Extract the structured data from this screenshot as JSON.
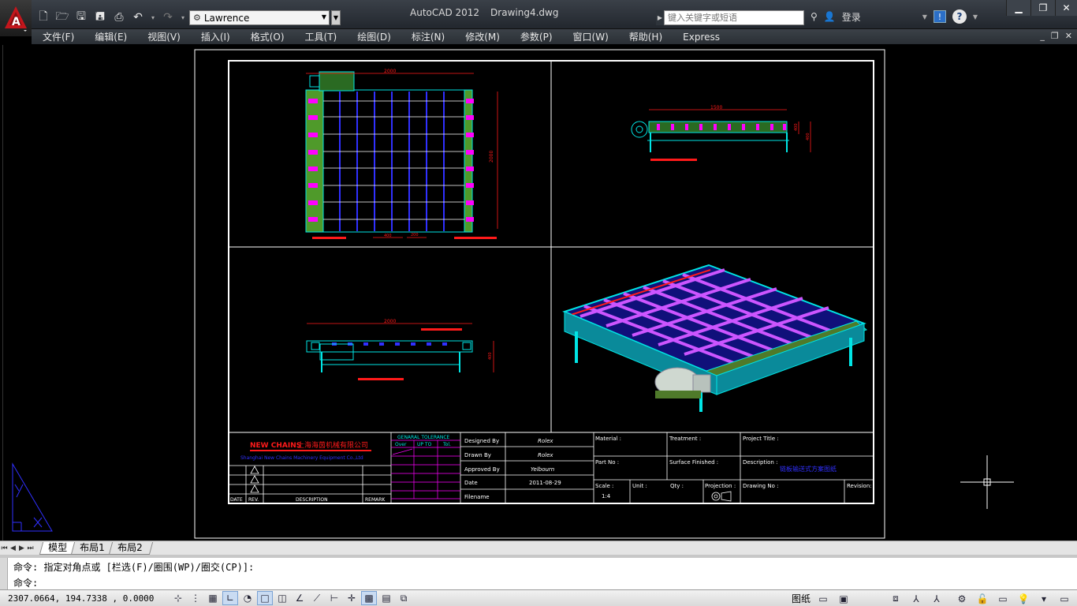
{
  "app": {
    "name": "AutoCAD 2012",
    "document": "Drawing4.dwg"
  },
  "quick_access": {
    "workspace": "Lawrence"
  },
  "search": {
    "placeholder": "键入关键字或短语"
  },
  "user": {
    "login_label": "登录"
  },
  "menus": [
    "文件(F)",
    "编辑(E)",
    "视图(V)",
    "插入(I)",
    "格式(O)",
    "工具(T)",
    "绘图(D)",
    "标注(N)",
    "修改(M)",
    "参数(P)",
    "窗口(W)",
    "帮助(H)",
    "Express"
  ],
  "drawing": {
    "dims": {
      "top_width": "2000",
      "top_height": "2000",
      "top_pitch": "400",
      "top_edge": "200",
      "side_width": "1500",
      "side_h1": "400",
      "side_h2": "400",
      "front_width": "2000",
      "front_height": "400"
    },
    "title_block": {
      "company_cn": "上海海茵机械有限公司",
      "company_en": "Shanghai New Chains Machinery Equipment Co.,Ltd",
      "brand": "NEW CHAINS",
      "tolerance_title": "GENARAL TOLERANCE",
      "tol_headers": [
        "Over",
        "UP TO",
        "Tol."
      ],
      "rev_headers": [
        "DATE",
        "REV.",
        "DESCRIPTION",
        "REMARK"
      ],
      "fields": {
        "designed_by_label": "Designed By",
        "designed_by": "Rolex",
        "drawn_by_label": "Drawn By",
        "drawn_by": "Rolex",
        "approved_by_label": "Approved By",
        "approved_by": "Yelbourn",
        "date_label": "Date",
        "date": "2011-08-29",
        "filename_label": "Filename",
        "material_label": "Material :",
        "treatment_label": "Treatment :",
        "project_title_label": "Project Title :",
        "part_no_label": "Part No :",
        "surface_label": "Surface Finished :",
        "description_label": "Description :",
        "description": "链板输送式方案图纸",
        "scale_label": "Scale :",
        "scale": "1:4",
        "unit_label": "Unit :",
        "qty_label": "Qty :",
        "projection_label": "Projection :",
        "drawing_no_label": "Drawing No :",
        "revision_label": "Revision:"
      }
    }
  },
  "layout_tabs": [
    "模型",
    "布局1",
    "布局2"
  ],
  "command": {
    "history": "命令: 指定对角点或 [栏选(F)/圈围(WP)/圈交(CP)]:",
    "prompt": "命令:"
  },
  "status": {
    "coords": "2307.0664, 194.7338 , 0.0000",
    "space": "图纸"
  },
  "colors": {
    "cyan": "#00e5e5",
    "magenta": "#ff00ff",
    "green": "#4f9a2a",
    "red": "#ff1a1a",
    "blue": "#3030ff",
    "white": "#ffffff"
  }
}
